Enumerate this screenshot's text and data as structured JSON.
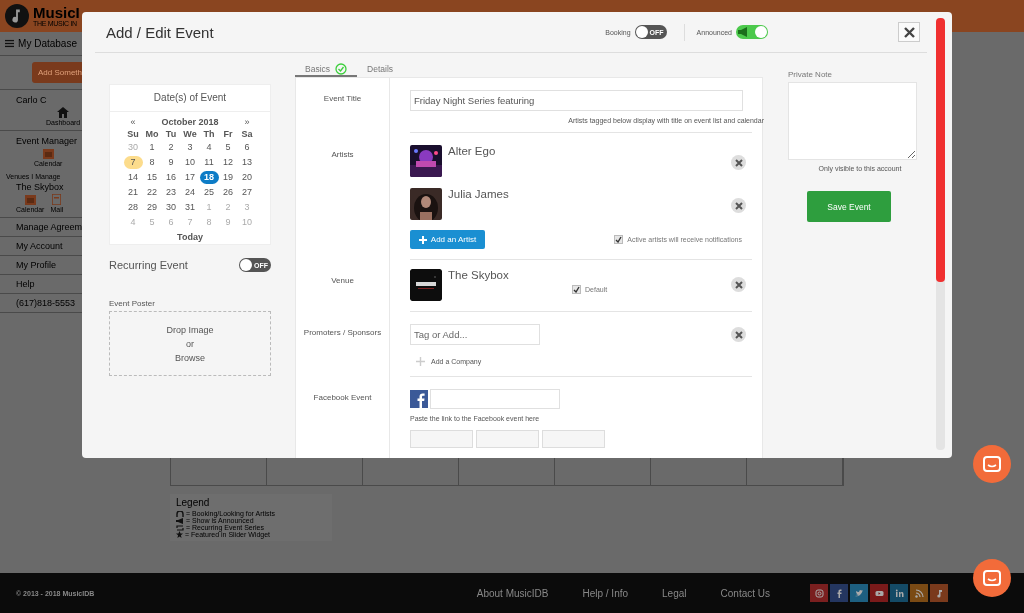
{
  "app": {
    "logo": "MusicI",
    "tagline": "THE MUSIC IN"
  },
  "sidebar": {
    "menu_label": "My Database",
    "add_button": "Add Someth",
    "user": "Carlo C",
    "user_links": [
      {
        "label": "Dashboard",
        "kind": "home"
      }
    ],
    "event_manager": {
      "title": "Event Manager",
      "links": [
        {
          "label": "Calendar",
          "kind": "calendar"
        }
      ]
    },
    "venues": {
      "heading": "Venues I Manage",
      "name": "The Skybox",
      "links": [
        {
          "label": "Calendar",
          "kind": "calendar"
        },
        {
          "label": "Mail",
          "kind": "mail"
        }
      ]
    },
    "items": [
      "Manage Agreem",
      "My Account",
      "My Profile",
      "Help",
      "(617)818-5553"
    ]
  },
  "modal": {
    "title": "Add / Edit Event",
    "booking": {
      "label": "Booking",
      "on": false,
      "state_text": "OFF"
    },
    "announced": {
      "label": "Announced",
      "on": true
    },
    "calendar": {
      "heading": "Date(s) of Event",
      "prev": "«",
      "month": "October 2018",
      "next": "»",
      "weekdays": [
        "Su",
        "Mo",
        "Tu",
        "We",
        "Th",
        "Fr",
        "Sa"
      ],
      "weeks": [
        [
          {
            "d": "30",
            "muted": true,
            "today": false,
            "selected": false
          },
          {
            "d": "1",
            "muted": false,
            "today": false,
            "selected": false
          },
          {
            "d": "2",
            "muted": false,
            "today": false,
            "selected": false
          },
          {
            "d": "3",
            "muted": false,
            "today": false,
            "selected": false
          },
          {
            "d": "4",
            "muted": false,
            "today": false,
            "selected": false
          },
          {
            "d": "5",
            "muted": false,
            "today": false,
            "selected": false
          },
          {
            "d": "6",
            "muted": false,
            "today": false,
            "selected": false
          }
        ],
        [
          {
            "d": "7",
            "muted": false,
            "today": true,
            "selected": false
          },
          {
            "d": "8",
            "muted": false,
            "today": false,
            "selected": false
          },
          {
            "d": "9",
            "muted": false,
            "today": false,
            "selected": false
          },
          {
            "d": "10",
            "muted": false,
            "today": false,
            "selected": false
          },
          {
            "d": "11",
            "muted": false,
            "today": false,
            "selected": false
          },
          {
            "d": "12",
            "muted": false,
            "today": false,
            "selected": false
          },
          {
            "d": "13",
            "muted": false,
            "today": false,
            "selected": false
          }
        ],
        [
          {
            "d": "14",
            "muted": false,
            "today": false,
            "selected": false
          },
          {
            "d": "15",
            "muted": false,
            "today": false,
            "selected": false
          },
          {
            "d": "16",
            "muted": false,
            "today": false,
            "selected": false
          },
          {
            "d": "17",
            "muted": false,
            "today": false,
            "selected": false
          },
          {
            "d": "18",
            "muted": false,
            "today": false,
            "selected": true
          },
          {
            "d": "19",
            "muted": false,
            "today": false,
            "selected": false
          },
          {
            "d": "20",
            "muted": false,
            "today": false,
            "selected": false
          }
        ],
        [
          {
            "d": "21",
            "muted": false,
            "today": false,
            "selected": false
          },
          {
            "d": "22",
            "muted": false,
            "today": false,
            "selected": false
          },
          {
            "d": "23",
            "muted": false,
            "today": false,
            "selected": false
          },
          {
            "d": "24",
            "muted": false,
            "today": false,
            "selected": false
          },
          {
            "d": "25",
            "muted": false,
            "today": false,
            "selected": false
          },
          {
            "d": "26",
            "muted": false,
            "today": false,
            "selected": false
          },
          {
            "d": "27",
            "muted": false,
            "today": false,
            "selected": false
          }
        ],
        [
          {
            "d": "28",
            "muted": false,
            "today": false,
            "selected": false
          },
          {
            "d": "29",
            "muted": false,
            "today": false,
            "selected": false
          },
          {
            "d": "30",
            "muted": false,
            "today": false,
            "selected": false
          },
          {
            "d": "31",
            "muted": false,
            "today": false,
            "selected": false
          },
          {
            "d": "1",
            "muted": true,
            "today": false,
            "selected": false
          },
          {
            "d": "2",
            "muted": true,
            "today": false,
            "selected": false
          },
          {
            "d": "3",
            "muted": true,
            "today": false,
            "selected": false
          }
        ],
        [
          {
            "d": "4",
            "muted": true,
            "today": false,
            "selected": false
          },
          {
            "d": "5",
            "muted": true,
            "today": false,
            "selected": false
          },
          {
            "d": "6",
            "muted": true,
            "today": false,
            "selected": false
          },
          {
            "d": "7",
            "muted": true,
            "today": false,
            "selected": false
          },
          {
            "d": "8",
            "muted": true,
            "today": false,
            "selected": false
          },
          {
            "d": "9",
            "muted": true,
            "today": false,
            "selected": false
          },
          {
            "d": "10",
            "muted": true,
            "today": false,
            "selected": false
          }
        ]
      ],
      "today_button": "Today"
    },
    "recurring": {
      "label": "Recurring Event",
      "on": false,
      "state_text": "OFF"
    },
    "poster": {
      "label": "Event Poster",
      "lines": [
        "Drop Image",
        "or",
        "Browse"
      ]
    },
    "tabs": [
      {
        "label": "Basics",
        "selected": true,
        "complete": true
      },
      {
        "label": "Details",
        "selected": false,
        "complete": false
      }
    ],
    "event_title": {
      "label": "Event Title",
      "value": "Friday Night Series featuring",
      "hint": "Artists tagged below display with title on event list and calendar"
    },
    "artists": {
      "label": "Artists",
      "items": [
        {
          "name": "Alter Ego",
          "kind": "picture"
        },
        {
          "name": "Julia James",
          "kind": "picture"
        }
      ],
      "add_button": "Add an Artist",
      "notify": {
        "label": "Active artists will receive notifications",
        "checked": true
      }
    },
    "venue": {
      "label": "Venue",
      "name": "The Skybox",
      "default": {
        "label": "Default",
        "checked": true
      }
    },
    "promoters": {
      "label": "Promoters / Sponsors",
      "placeholder": "Tag or Add...",
      "add_link": "Add a Company"
    },
    "facebook": {
      "label": "Facebook Event",
      "hint": "Paste the link to the Facebook event here"
    },
    "private_note": {
      "label": "Private Note",
      "hint": "Only visible to this account"
    },
    "save_button": "Save Event"
  },
  "legend": {
    "title": "Legend",
    "items": [
      {
        "kind": "booking",
        "text": "= Booking/Looking for Artists"
      },
      {
        "kind": "announced",
        "text": "= Show is Announced"
      },
      {
        "kind": "recurring",
        "text": "= Recurring Event Series"
      },
      {
        "kind": "featured",
        "text": "= Featured in Slider Widget"
      }
    ]
  },
  "footer": {
    "copyright": "© 2013 - 2018 MusicIDB",
    "links": [
      "About MusicIDB",
      "Help / Info",
      "Legal",
      "Contact Us"
    ],
    "social": [
      {
        "kind": "instagram",
        "color": "#7a1f1f"
      },
      {
        "kind": "facebook",
        "color": "#243660"
      },
      {
        "kind": "twitter",
        "color": "#1d5f80"
      },
      {
        "kind": "youtube",
        "color": "#7a1a1a"
      },
      {
        "kind": "linkedin",
        "color": "#144a66"
      },
      {
        "kind": "rss",
        "color": "#7a4a14"
      },
      {
        "kind": "music",
        "color": "#7a3a1c"
      }
    ]
  }
}
